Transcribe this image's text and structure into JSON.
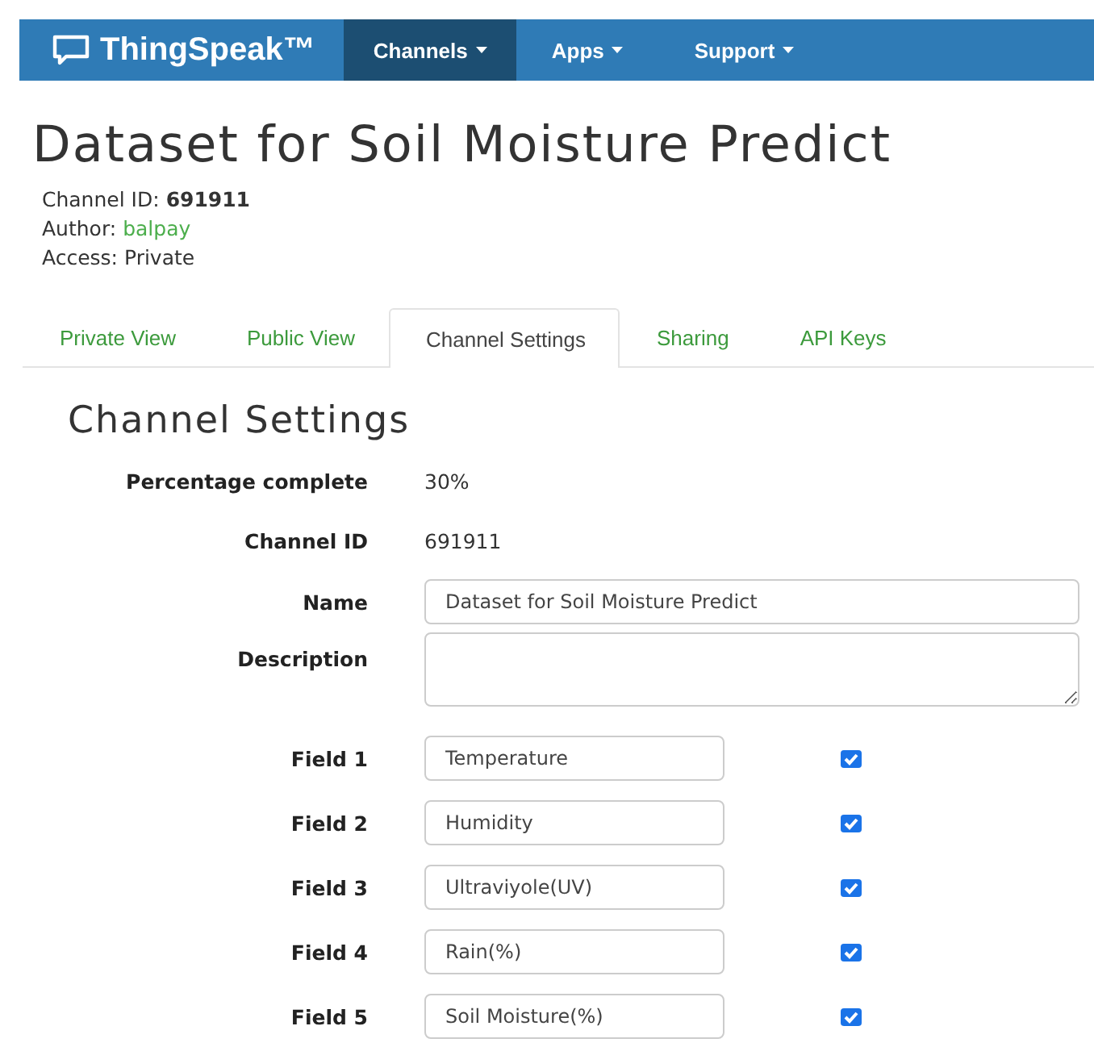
{
  "navbar": {
    "brand": "ThingSpeak™",
    "items": [
      {
        "label": "Channels",
        "selected": true
      },
      {
        "label": "Apps",
        "selected": false
      },
      {
        "label": "Support",
        "selected": false
      }
    ]
  },
  "title": "Dataset for Soil Moisture Predict",
  "meta": [
    {
      "label": "Channel ID:",
      "value": "691911",
      "kind": "bold"
    },
    {
      "label": "Author:",
      "value": "balpay",
      "kind": "link"
    },
    {
      "label": "Access:",
      "value": "Private",
      "kind": "plain"
    }
  ],
  "tabs": [
    {
      "label": "Private View",
      "selected": false
    },
    {
      "label": "Public View",
      "selected": false
    },
    {
      "label": "Channel Settings",
      "selected": true
    },
    {
      "label": "Sharing",
      "selected": false
    },
    {
      "label": "API Keys",
      "selected": false
    }
  ],
  "settings": {
    "heading": "Channel Settings",
    "rows": [
      {
        "kind": "text",
        "label": "Percentage complete",
        "value": "30%"
      },
      {
        "kind": "text",
        "label": "Channel ID",
        "value": "691911"
      },
      {
        "kind": "input",
        "label": "Name",
        "value": "Dataset for Soil Moisture Predict"
      },
      {
        "kind": "textarea",
        "label": "Description"
      },
      {
        "kind": "field",
        "label": "Field 1",
        "value": "Temperature",
        "checked": true
      },
      {
        "kind": "field",
        "label": "Field 2",
        "value": "Humidity",
        "checked": true
      },
      {
        "kind": "field",
        "label": "Field 3",
        "value": "Ultraviyole(UV)",
        "checked": true
      },
      {
        "kind": "field",
        "label": "Field 4",
        "value": "Rain(%)",
        "checked": true
      },
      {
        "kind": "field",
        "label": "Field 5",
        "value": "Soil Moisture(%)",
        "checked": true
      }
    ]
  }
}
